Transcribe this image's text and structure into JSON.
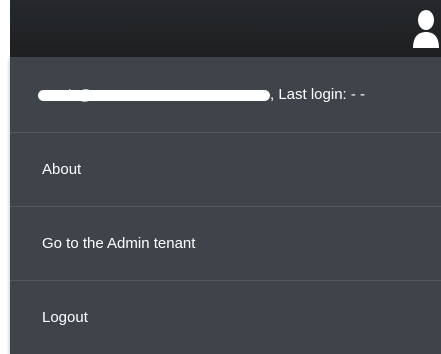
{
  "header": {
    "user_icon": "user-silhouette-icon"
  },
  "user_menu": {
    "account": {
      "redacted_text": "l@",
      "last_login_label": ", Last login: - -"
    },
    "items": [
      {
        "label": "About"
      },
      {
        "label": "Go to the Admin tenant"
      },
      {
        "label": "Logout"
      }
    ]
  },
  "colors": {
    "header_bg": "#1f2123",
    "menu_bg": "#3e4449",
    "divider": "#53595e",
    "text": "#ffffff"
  }
}
